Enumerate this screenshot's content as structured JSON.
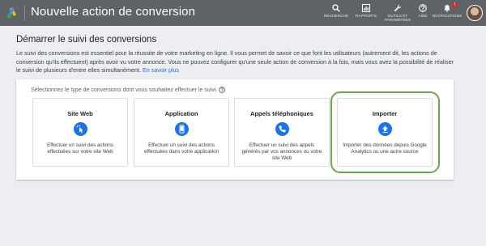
{
  "header": {
    "title": "Nouvelle action de conversion",
    "nav": [
      {
        "label": "RECHERCHE",
        "icon": "search-icon"
      },
      {
        "label": "RAPPORTS",
        "icon": "reports-icon"
      },
      {
        "label": "OUTILS ET PARAMÈTRES",
        "icon": "wrench-icon"
      },
      {
        "label": "AIDE",
        "icon": "help-icon"
      },
      {
        "label": "NOTIFICATIONS",
        "icon": "bell-icon",
        "badge": "!"
      }
    ]
  },
  "main": {
    "title": "Démarrer le suivi des conversions",
    "intro": "Le suivi des conversions est essentiel pour la réussite de votre marketing en ligne. Il vous permet de savoir ce que font les utilisateurs (autrement dit, les actions de conversion qu'ils effectuent) après avoir vu votre annonce. Vous ne pouvez configurer qu'une seule action de conversion à la fois, mais vous avez la possibilité de réaliser le suivi de plusieurs d'entre elles simultanément.",
    "learn_more": "En savoir plus",
    "prompt": "Sélectionnez le type de conversions dont vous souhaitez effectuer le suivi.",
    "cards": [
      {
        "title": "Site Web",
        "icon": "cursor-click-icon",
        "description": "Effectuer un suivi des actions effectuées sur votre site Web"
      },
      {
        "title": "Application",
        "icon": "smartphone-icon",
        "description": "Effectuer un suivi des actions effectuées dans votre application"
      },
      {
        "title": "Appels téléphoniques",
        "icon": "phone-icon",
        "description": "Effectuer un suivi des appels générés par vos annonces ou votre site Web"
      },
      {
        "title": "Importer",
        "icon": "upload-icon",
        "description": "Importer des données depuis Google Analytics ou une autre source"
      }
    ]
  },
  "colors": {
    "topbar": "#5f6368",
    "accent": "#1a73e8",
    "highlight": "#6aa84f"
  }
}
